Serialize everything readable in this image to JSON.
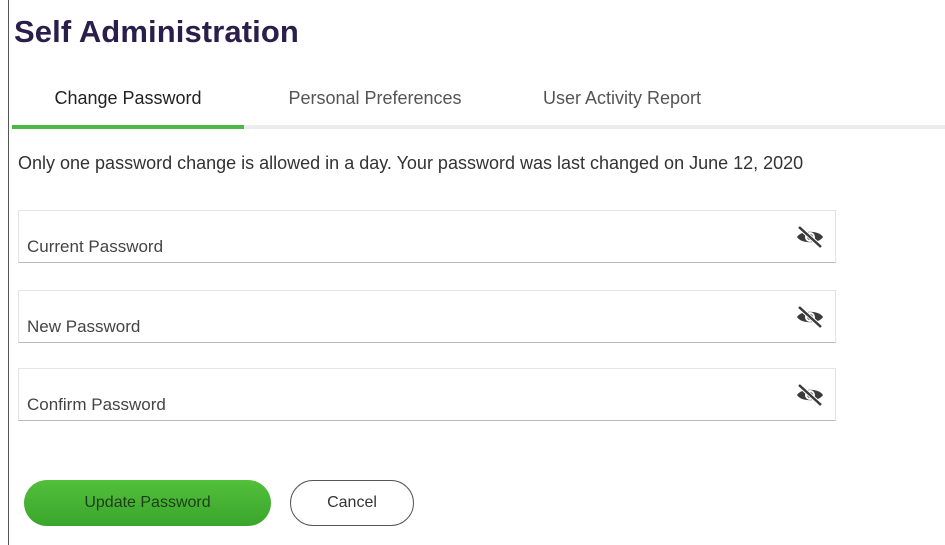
{
  "page": {
    "title": "Self Administration"
  },
  "tabs": [
    {
      "label": "Change Password",
      "active": true
    },
    {
      "label": "Personal Preferences",
      "active": false
    },
    {
      "label": "User Activity Report",
      "active": false
    }
  ],
  "notice": "Only one password change is allowed in a day. Your password was last changed on June 12, 2020",
  "fields": [
    {
      "label": "Current Password",
      "value": "",
      "icon": "eye-slash-icon"
    },
    {
      "label": "New Password",
      "value": "",
      "icon": "eye-slash-icon"
    },
    {
      "label": "Confirm Password",
      "value": "",
      "icon": "eye-slash-icon"
    }
  ],
  "actions": {
    "update_label": "Update Password",
    "cancel_label": "Cancel"
  },
  "colors": {
    "title": "#2a1e4a",
    "accent": "#4cb848",
    "primary_button": "#45b233"
  }
}
